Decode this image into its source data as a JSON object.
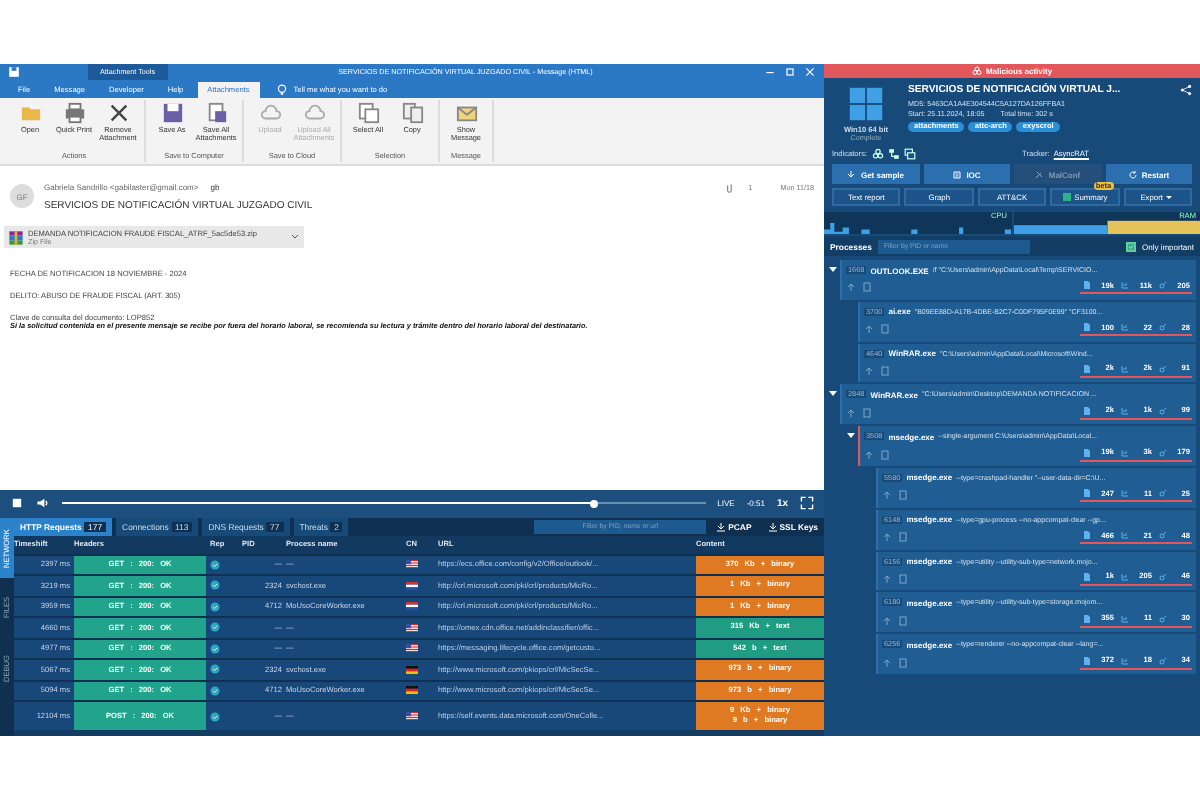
{
  "outlook": {
    "context_tab": "Attachment Tools",
    "title": "SERVICIOS DE NOTIFICACIÓN VIRTUAL JUZGADO CIVIL  -  Message (HTML)",
    "tabs": [
      {
        "label": "File",
        "selected": false
      },
      {
        "label": "Message",
        "selected": false
      },
      {
        "label": "Developer",
        "selected": false
      },
      {
        "label": "Help",
        "selected": false
      },
      {
        "label": "Attachments",
        "selected": true
      }
    ],
    "tell_me": "Tell me what you want to do",
    "ribbon_groups": [
      {
        "label": "Actions",
        "buttons": [
          {
            "label": "Open",
            "disabled": false
          },
          {
            "label": "Quick Print",
            "disabled": false
          },
          {
            "label": "Remove Attachment",
            "disabled": false
          }
        ]
      },
      {
        "label": "Save to Computer",
        "buttons": [
          {
            "label": "Save As",
            "disabled": false
          },
          {
            "label": "Save All Attachments",
            "disabled": false
          }
        ]
      },
      {
        "label": "Save to Cloud",
        "buttons": [
          {
            "label": "Upload",
            "disabled": true
          },
          {
            "label": "Upload All Attachments",
            "disabled": true
          }
        ]
      },
      {
        "label": "Selection",
        "buttons": [
          {
            "label": "Select All",
            "disabled": false
          },
          {
            "label": "Copy",
            "disabled": false
          }
        ]
      },
      {
        "label": "Message",
        "buttons": [
          {
            "label": "Show Message",
            "disabled": false
          }
        ]
      }
    ],
    "message": {
      "avatar": "GF",
      "from": "Gabriela Sandrillo <gabilaster@gmail.com>",
      "to": "gb",
      "attachment_count": "1",
      "date": "Mon 11/18",
      "subject": "SERVICIOS DE NOTIFICACIÓN VIRTUAL JUZGADO CIVIL",
      "attachment": {
        "name": "DEMANDA NOTIFICACION FRAUDE FISCAL_ATRF_5ac5de53.zip",
        "type": "Zip File"
      },
      "paragraphs": [
        [
          {
            "kind": "plain",
            "text": "FECHA DE NOTIFICACION 18 NOVIEMBRE - 2024"
          }
        ],
        [
          {
            "kind": "plain",
            "text": "DELITO: ABUSO DE FRAUDE FISCAL (ART. 305)"
          }
        ],
        [
          {
            "kind": "plain",
            "text": "Clave de consulta del documento: LOP852"
          },
          {
            "kind": "emphasis",
            "text": "Si la solicitud contenida en el presente mensaje se recibe por fuera del horario laboral, se recomienda su lectura y trámite dentro del horario laboral del destinatario."
          }
        ]
      ]
    }
  },
  "player": {
    "level": 0.83,
    "live": "LIVE",
    "remaining": "-0:51",
    "speed": "1x"
  },
  "network": {
    "side_tabs": [
      {
        "label": "NETWORK",
        "selected": true
      },
      {
        "label": "FILES",
        "selected": false
      },
      {
        "label": "DEBUG",
        "selected": false
      }
    ],
    "tabs": [
      {
        "label": "HTTP Requests",
        "count": "177",
        "selected": true
      },
      {
        "label": "Connections",
        "count": "113",
        "selected": false
      },
      {
        "label": "DNS Requests",
        "count": "77",
        "selected": false
      },
      {
        "label": "Threats",
        "count": "2",
        "selected": false
      }
    ],
    "filter_placeholder": "Filter by PID, name or url",
    "actions": [
      "PCAP",
      "SSL Keys"
    ],
    "columns": [
      "Timeshift",
      "Headers",
      "Rep",
      "PID",
      "Process name",
      "CN",
      "URL",
      "Content"
    ],
    "rows": [
      {
        "time": "2397 ms",
        "headers": "GET : 200: OK",
        "pid": "—",
        "process": "—",
        "kind": "us",
        "url": "https://ecs.office.com/config/v2/Office/outlook/...",
        "content": [
          "370 Kb + binary"
        ],
        "color": "#e07a22"
      },
      {
        "time": "3219 ms",
        "headers": "GET : 200: OK",
        "pid": "2324",
        "process": "svchost.exe",
        "kind": "nl",
        "url": "http://crl.microsoft.com/pki/crl/products/MicRo...",
        "content": [
          "1 Kb + binary"
        ],
        "color": "#e07a22"
      },
      {
        "time": "3959 ms",
        "headers": "GET : 200: OK",
        "pid": "4712",
        "process": "MoUsoCoreWorker.exe",
        "kind": "nl",
        "url": "http://crl.microsoft.com/pki/crl/products/MicRo...",
        "content": [
          "1 Kb + binary"
        ],
        "color": "#e07a22"
      },
      {
        "time": "4660 ms",
        "headers": "GET : 200: OK",
        "pid": "—",
        "process": "—",
        "kind": "us",
        "url": "https://omex.cdn.office.net/addinclassifier/offic...",
        "content": [
          "315 Kb + text"
        ],
        "color": "#1f9c82"
      },
      {
        "time": "4977 ms",
        "headers": "GET : 200: OK",
        "pid": "—",
        "process": "—",
        "kind": "us",
        "url": "https://messaging.lifecycle.office.com/getcusto...",
        "content": [
          "542 b + text"
        ],
        "color": "#1f9c82"
      },
      {
        "time": "5067 ms",
        "headers": "GET : 200: OK",
        "pid": "2324",
        "process": "svchost.exe",
        "kind": "de",
        "url": "http://www.microsoft.com/pkiops/crl/MicSecSe...",
        "content": [
          "973 b + binary"
        ],
        "color": "#e07a22"
      },
      {
        "time": "5094 ms",
        "headers": "GET : 200: OK",
        "pid": "4712",
        "process": "MoUsoCoreWorker.exe",
        "kind": "de",
        "url": "http://www.microsoft.com/pkiops/crl/MicSecSe...",
        "content": [
          "973 b + binary"
        ],
        "color": "#e07a22"
      },
      {
        "time": "12104 ms",
        "headers": "POST : 200: OK",
        "pid": "—",
        "process": "—",
        "kind": "us",
        "url": "https://self.events.data.microsoft.com/OneColle...",
        "content": [
          "9 Kb + binary",
          "9 b + binary"
        ],
        "color": "#e07a22"
      }
    ]
  },
  "report": {
    "verdict": "Malicious activity",
    "os": "Win10 64 bit",
    "status": "Complete",
    "title": "SERVICIOS DE NOTIFICACIÓN VIRTUAL J...",
    "md5": "MD5: 5463CA1A4E304544C5A127DA126FFBA1",
    "start": "Start: 25.11.2024, 18:05",
    "total_time": "Total time: 302 s",
    "tags": [
      "attachments",
      "attc-arch",
      "exyscrol"
    ],
    "indicators_label": "Indicators:",
    "tracker_label": "Tracker:",
    "tracker": "AsyncRAT",
    "actions": [
      {
        "label": "Get sample",
        "disabled": false
      },
      {
        "label": "IOC",
        "disabled": false
      },
      {
        "label": "MalConf",
        "disabled": true
      },
      {
        "label": "Restart",
        "disabled": false
      }
    ],
    "views": [
      {
        "label": "Text report",
        "kind": "plain"
      },
      {
        "label": "Graph",
        "kind": "plain"
      },
      {
        "label": "ATT&CK",
        "kind": "plain"
      },
      {
        "label": "Summary",
        "kind": "badged",
        "badge": "beta"
      },
      {
        "label": "Export",
        "kind": "menu"
      }
    ],
    "graphs": [
      "CPU",
      "RAM"
    ],
    "processes": {
      "label": "Processes",
      "placeholder": "Filter by PID or name",
      "only_important": {
        "label": "Only important",
        "checked": true
      },
      "tree": [
        {
          "pid": "1668",
          "name": "OUTLOOK.EXE",
          "cmd": "/f \"C:\\Users\\admin\\AppData\\Local\\Temp\\SERVICIO...",
          "malicious": false,
          "stats": [
            "19k",
            "11k",
            "205"
          ],
          "expanded": true,
          "children": [
            {
              "pid": "3700",
              "name": "ai.exe",
              "cmd": "\"B09EE88D-A17B-4DBE-B2C7-C0DF795F0E99\" \"CF3100...",
              "malicious": false,
              "stats": [
                "100",
                "22",
                "28"
              ]
            },
            {
              "pid": "4640",
              "name": "WinRAR.exe",
              "cmd": "\"C:\\Users\\admin\\AppData\\Local\\Microsoft\\Wind...",
              "malicious": false,
              "stats": [
                "2k",
                "2k",
                "91"
              ]
            }
          ]
        },
        {
          "pid": "2848",
          "name": "WinRAR.exe",
          "cmd": "\"C:\\Users\\admin\\Desktop\\DEMANDA NOTIFICACION ...",
          "malicious": false,
          "stats": [
            "2k",
            "1k",
            "99"
          ],
          "expanded": true,
          "children": [
            {
              "pid": "3508",
              "name": "msedge.exe",
              "cmd": "--single-argument C:\\Users\\admin\\AppData\\Local...",
              "malicious": true,
              "stats": [
                "19k",
                "3k",
                "179"
              ],
              "expanded": true,
              "children": [
                {
                  "pid": "5580",
                  "name": "msedge.exe",
                  "cmd": "--type=crashpad-handler \"--user-data-dir=C:\\U...",
                  "malicious": false,
                  "stats": [
                    "247",
                    "11",
                    "25"
                  ]
                },
                {
                  "pid": "6148",
                  "name": "msedge.exe",
                  "cmd": "--type=gpu-process --no-appcompat-clear --gp...",
                  "malicious": false,
                  "stats": [
                    "466",
                    "21",
                    "48"
                  ]
                },
                {
                  "pid": "6156",
                  "name": "msedge.exe",
                  "cmd": "--type=utility --utility-sub-type=network.mojo...",
                  "malicious": false,
                  "stats": [
                    "1k",
                    "205",
                    "46"
                  ]
                },
                {
                  "pid": "6180",
                  "name": "msedge.exe",
                  "cmd": "--type=utility --utility-sub-type=storage.mojom...",
                  "malicious": false,
                  "stats": [
                    "355",
                    "11",
                    "30"
                  ]
                },
                {
                  "pid": "6256",
                  "name": "msedge.exe",
                  "cmd": "--type=renderer --no-appcompat-clear --lang=...",
                  "malicious": false,
                  "stats": [
                    "372",
                    "18",
                    "34"
                  ]
                }
              ]
            }
          ]
        }
      ]
    }
  }
}
